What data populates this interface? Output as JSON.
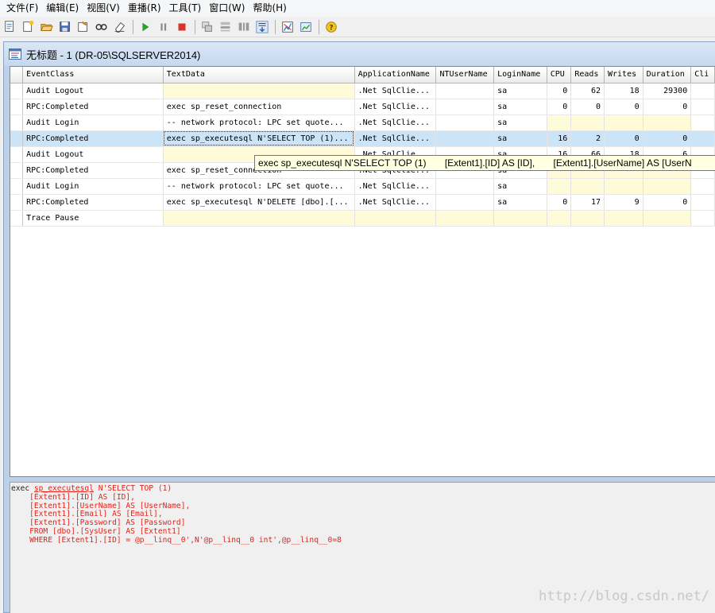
{
  "menu": [
    "文件(F)",
    "编辑(E)",
    "视图(V)",
    "重播(R)",
    "工具(T)",
    "窗口(W)",
    "帮助(H)"
  ],
  "toolbar": {
    "groups": [
      [
        "new-trace-icon",
        "new-template-icon",
        "open-icon",
        "save-icon",
        "properties-icon",
        "find-icon",
        "clear-icon"
      ],
      [
        "run-icon",
        "pause-icon",
        "stop-icon"
      ],
      [
        "group-icon",
        "ungroup-icon",
        "columns-icon",
        "autoscroll-icon"
      ],
      [
        "perfmon-icon",
        "chart-icon"
      ],
      [
        "help-icon"
      ]
    ]
  },
  "window": {
    "title": "无标题 - 1 (DR-05\\SQLSERVER2014)"
  },
  "grid": {
    "columns": [
      "EventClass",
      "TextData",
      "ApplicationName",
      "NTUserName",
      "LoginName",
      "CPU",
      "Reads",
      "Writes",
      "Duration",
      "Cli"
    ],
    "rows": [
      {
        "event": "Audit Logout",
        "text": "",
        "app": ".Net SqlClie...",
        "nt": "",
        "login": "sa",
        "cpu": "0",
        "reads": "62",
        "writes": "18",
        "duration": "29300",
        "cli": "",
        "selected": false
      },
      {
        "event": "RPC:Completed",
        "text": "exec sp_reset_connection",
        "app": ".Net SqlClie...",
        "nt": "",
        "login": "sa",
        "cpu": "0",
        "reads": "0",
        "writes": "0",
        "duration": "0",
        "cli": "",
        "selected": false
      },
      {
        "event": "Audit Login",
        "text": "-- network protocol: LPC  set quote...",
        "app": ".Net SqlClie...",
        "nt": "",
        "login": "sa",
        "cpu": "",
        "reads": "",
        "writes": "",
        "duration": "",
        "cli": "",
        "selected": false
      },
      {
        "event": "RPC:Completed",
        "text": "exec sp_executesql N'SELECT TOP (1)...",
        "app": ".Net SqlClie...",
        "nt": "",
        "login": "sa",
        "cpu": "16",
        "reads": "2",
        "writes": "0",
        "duration": "0",
        "cli": "",
        "selected": true
      },
      {
        "event": "Audit Logout",
        "text": "",
        "app": ".Net SqlClie...",
        "nt": "",
        "login": "sa",
        "cpu": "16",
        "reads": "66",
        "writes": "18",
        "duration": "6",
        "cli": "",
        "selected": false
      },
      {
        "event": "RPC:Completed",
        "text": "exec sp_reset_connection",
        "app": ".Net SqlClie...",
        "nt": "",
        "login": "sa",
        "cpu": "",
        "reads": "",
        "writes": "",
        "duration": "",
        "cli": "",
        "selected": false
      },
      {
        "event": "Audit Login",
        "text": "-- network protocol: LPC  set quote...",
        "app": ".Net SqlClie...",
        "nt": "",
        "login": "sa",
        "cpu": "",
        "reads": "",
        "writes": "",
        "duration": "",
        "cli": "",
        "selected": false
      },
      {
        "event": "RPC:Completed",
        "text": "exec sp_executesql N'DELETE [dbo].[...",
        "app": ".Net SqlClie...",
        "nt": "",
        "login": "sa",
        "cpu": "0",
        "reads": "17",
        "writes": "9",
        "duration": "0",
        "cli": "",
        "selected": false
      },
      {
        "event": "Trace Pause",
        "text": "",
        "app": "",
        "nt": "",
        "login": "",
        "cpu": "",
        "reads": "",
        "writes": "",
        "duration": "",
        "cli": "",
        "selected": false
      }
    ]
  },
  "tooltip": "exec sp_executesql N'SELECT TOP (1)       [Extent1].[ID] AS [ID],       [Extent1].[UserName] AS [UserN",
  "detail": {
    "line1_exec": "exec",
    "line1_proc": "sp_executesql",
    "line1_rest": "N'SELECT TOP (1)",
    "lines": [
      "    [Extent1].[ID] AS [ID],",
      "    [Extent1].[UserName] AS [UserName],",
      "    [Extent1].[Email] AS [Email],",
      "    [Extent1].[Password] AS [Password]",
      "    FROM [dbo].[SysUser] AS [Extent1]",
      "    WHERE [Extent1].[ID] = @p__linq__0',N'@p__linq__0 int',@p__linq__0=8"
    ]
  },
  "watermark": "http://blog.csdn.net/"
}
